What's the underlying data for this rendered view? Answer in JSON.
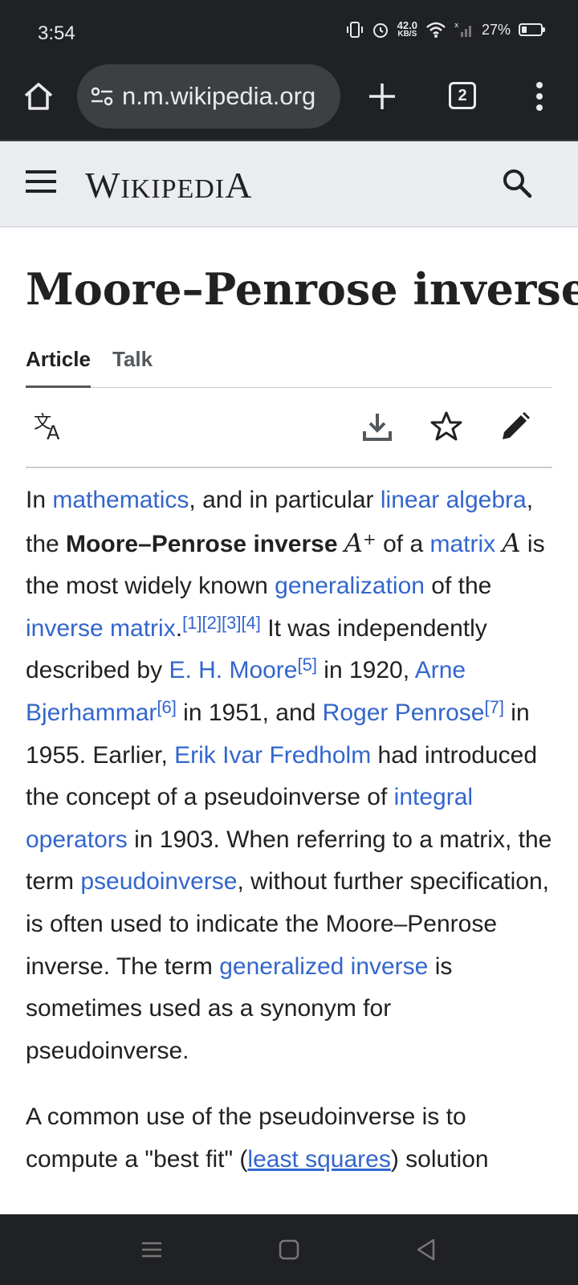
{
  "status_bar": {
    "time": "3:54",
    "net_speed_value": "42.0",
    "net_speed_unit": "KB/S",
    "battery_percent": "27%",
    "battery_level": 0.27
  },
  "browser": {
    "url": "n.m.wikipedia.org",
    "tab_count": "2"
  },
  "wiki": {
    "wordmark_first": "W",
    "wordmark_mid": "IKIPEDI",
    "wordmark_last": "A"
  },
  "article": {
    "title": "Moore–Penrose inverse",
    "tabs": [
      "Article",
      "Talk"
    ]
  },
  "paragraph1": {
    "t1": "In ",
    "l_mathematics": "mathematics",
    "t2": ", and in particular ",
    "l_linear_algebra": "linear algebra",
    "t3": ", the ",
    "bold_term": "Moore–Penrose inverse",
    "math_A": "A",
    "math_plus": "+",
    "t4": " of a ",
    "l_matrix": "matrix",
    "t5": " is the most widely known ",
    "l_generalization": "generalization",
    "t6": " of the ",
    "l_inverse_matrix": "inverse matrix",
    "t7": ".",
    "refs1": "[1][2][3][4]",
    "t8": " It was independently described by ",
    "l_moore": "E. H. Moore",
    "ref5": "[5]",
    "t9": " in 1920, ",
    "l_bjerhammar": "Arne Bjerhammar",
    "ref6": "[6]",
    "t10": " in 1951, and ",
    "l_penrose": "Roger Penrose",
    "ref7": "[7]",
    "t11": " in 1955. Earlier, ",
    "l_fredholm": "Erik Ivar Fredholm",
    "t12": " had introduced the concept of a pseudoinverse of ",
    "l_integral": "integral operators",
    "t13": " in 1903. When referring to a matrix, the term ",
    "l_pseudoinverse": "pseudoinverse",
    "t14": ", without further specification, is often used to indicate the Moore–Penrose inverse. The term ",
    "l_generalized": "generalized inverse",
    "t15": " is sometimes used as a synonym for pseudoinverse."
  },
  "paragraph2": {
    "t1": "A common use of the pseudoinverse is to compute a \"best fit\" (",
    "l_least_squares": "least squares",
    "t2": ") solution"
  },
  "colors": {
    "link": "#3366cc",
    "text": "#202122",
    "chrome_bg": "#202124",
    "header_bg": "#eaecf0"
  }
}
